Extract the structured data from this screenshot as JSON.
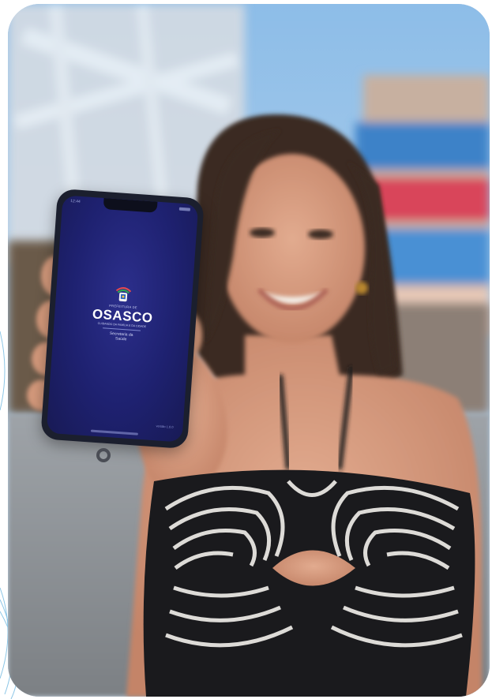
{
  "photo": {
    "description_colors": {
      "sky": "#7fb2e0",
      "dress_black": "#1a1a1d",
      "dress_white": "#e8e6e2",
      "skin": "#d39a7e",
      "hair": "#3a2a22"
    }
  },
  "phone": {
    "status_time": "12:44",
    "app": {
      "prefix": "PREFEITURA DE",
      "title": "OSASCO",
      "tagline": "CUIDANDO DA FAMÍLIA E DA CIDADE",
      "department_line1": "Secretaria da",
      "department_line2": "Saúde",
      "version": "versão 1.0.0"
    },
    "colors": {
      "screen": "#1e2170",
      "frame": "#1b1f2e"
    }
  }
}
